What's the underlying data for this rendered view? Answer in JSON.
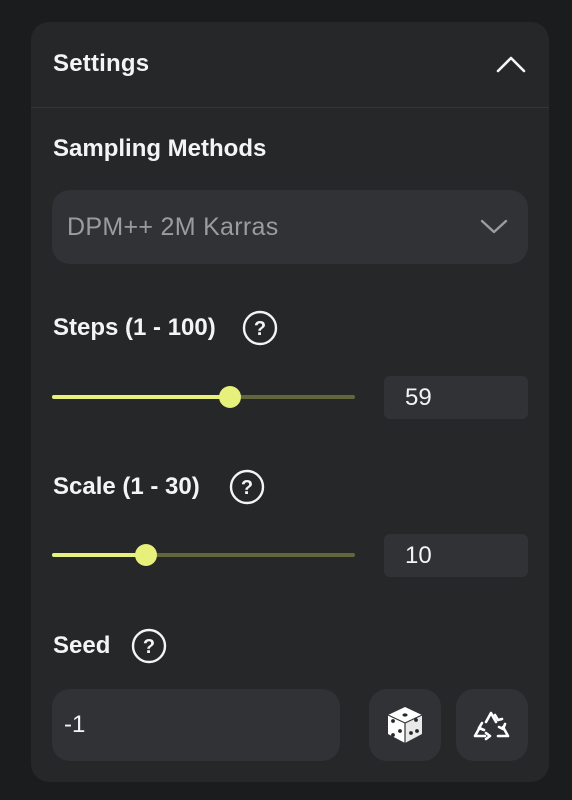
{
  "settings": {
    "title": "Settings",
    "collapse_icon": "chevron-up-icon"
  },
  "sampling": {
    "label": "Sampling Methods",
    "selected": "DPM++ 2M Karras",
    "icon": "chevron-down-icon"
  },
  "steps": {
    "label": "Steps (1 - 100)",
    "value": "59",
    "min": 1,
    "max": 100,
    "current": 59,
    "help_icon": "question-circle-icon"
  },
  "scale": {
    "label": "Scale (1 - 30)",
    "value": "10",
    "min": 1,
    "max": 30,
    "current": 10,
    "help_icon": "question-circle-icon"
  },
  "seed": {
    "label": "Seed",
    "value": "-1",
    "help_icon": "question-circle-icon",
    "random_icon": "dice-icon",
    "recycle_icon": "recycle-icon"
  },
  "colors": {
    "accent": "#e6f07a",
    "panel": "#262729",
    "field": "#313235",
    "background": "#1b1c1e"
  }
}
